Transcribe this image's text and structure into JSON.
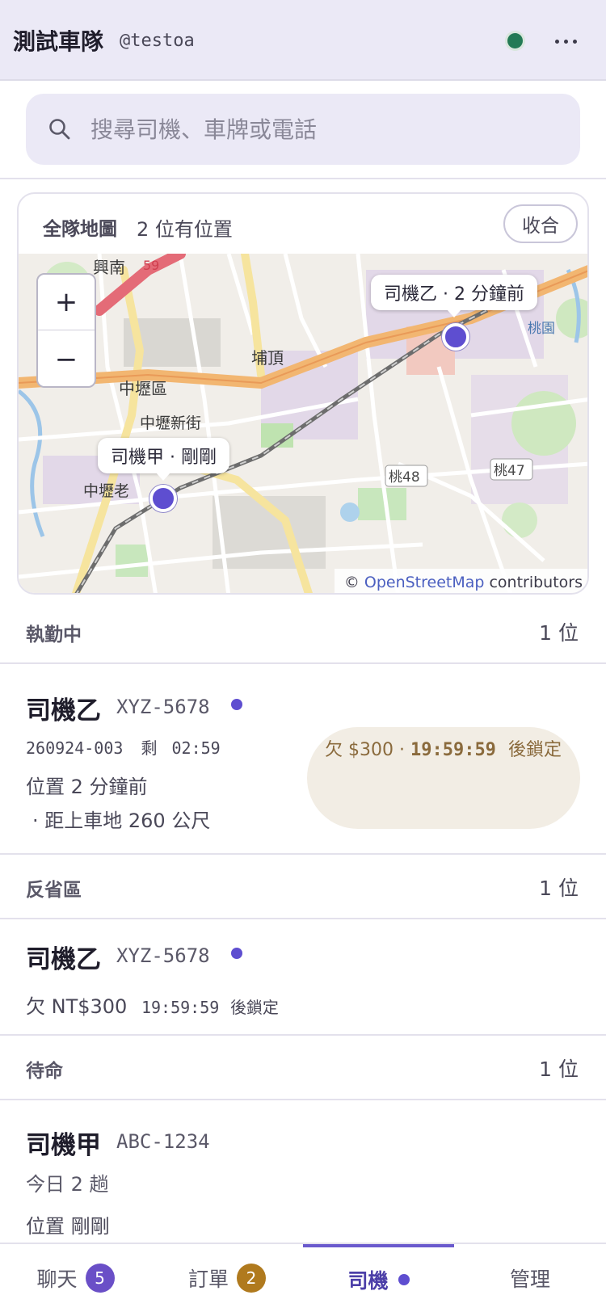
{
  "header": {
    "team_name": "測試車隊",
    "handle": "@testoa",
    "status_color": "#237a55"
  },
  "search": {
    "placeholder": "搜尋司機、車牌或電話"
  },
  "map_card": {
    "title": "全隊地圖",
    "count": "2 位有位置",
    "collapse_label": "收合",
    "zoom_in": "+",
    "zoom_out": "−",
    "labels": [
      "司機乙 · 2 分鐘前",
      "司機甲 · 剛剛"
    ],
    "attribution": {
      "prefix": "©",
      "link": "OpenStreetMap",
      "suffix": "contributors"
    },
    "place_names": [
      "興南",
      "59",
      "中壢區",
      "中壢新街",
      "埔頂",
      "中壢老",
      "桃48",
      "桃47",
      "桃園"
    ]
  },
  "sections": {
    "on_duty": {
      "title": "執勤中",
      "count": "1 位"
    },
    "reflection": {
      "title": "反省區",
      "count": "1 位"
    },
    "standby": {
      "title": "待命",
      "count": "1 位"
    }
  },
  "on_duty_card": {
    "name": "司機乙",
    "plate": "XYZ-5678",
    "order": "260924-003",
    "remaining_label": "剩",
    "remaining": "02:59",
    "location": "位置 2 分鐘前",
    "distance": "· 距上車地 260 公尺",
    "debt_prefix": "欠 $300 ·",
    "debt_time": "19:59:59",
    "debt_suffix": "後鎖定"
  },
  "reflection_card": {
    "name": "司機乙",
    "plate": "XYZ-5678",
    "debt": "欠 NT$300",
    "lock_time": "19:59:59",
    "lock_suffix": "後鎖定"
  },
  "standby_card": {
    "name": "司機甲",
    "plate": "ABC-1234",
    "trips": "今日 2 趟",
    "location": "位置 剛剛"
  },
  "bottom_nav": {
    "chat": {
      "label": "聊天",
      "badge": "5",
      "badge_color": "#6a4fc7"
    },
    "orders": {
      "label": "訂單",
      "badge": "2",
      "badge_color": "#b07a1e"
    },
    "drivers": {
      "label": "司機"
    },
    "manage": {
      "label": "管理"
    }
  },
  "colors": {
    "accent": "#5e4ed0",
    "header_bg": "#ebe9f6",
    "debt_bg": "#f2ede4",
    "debt_text": "#8a6a3c"
  }
}
